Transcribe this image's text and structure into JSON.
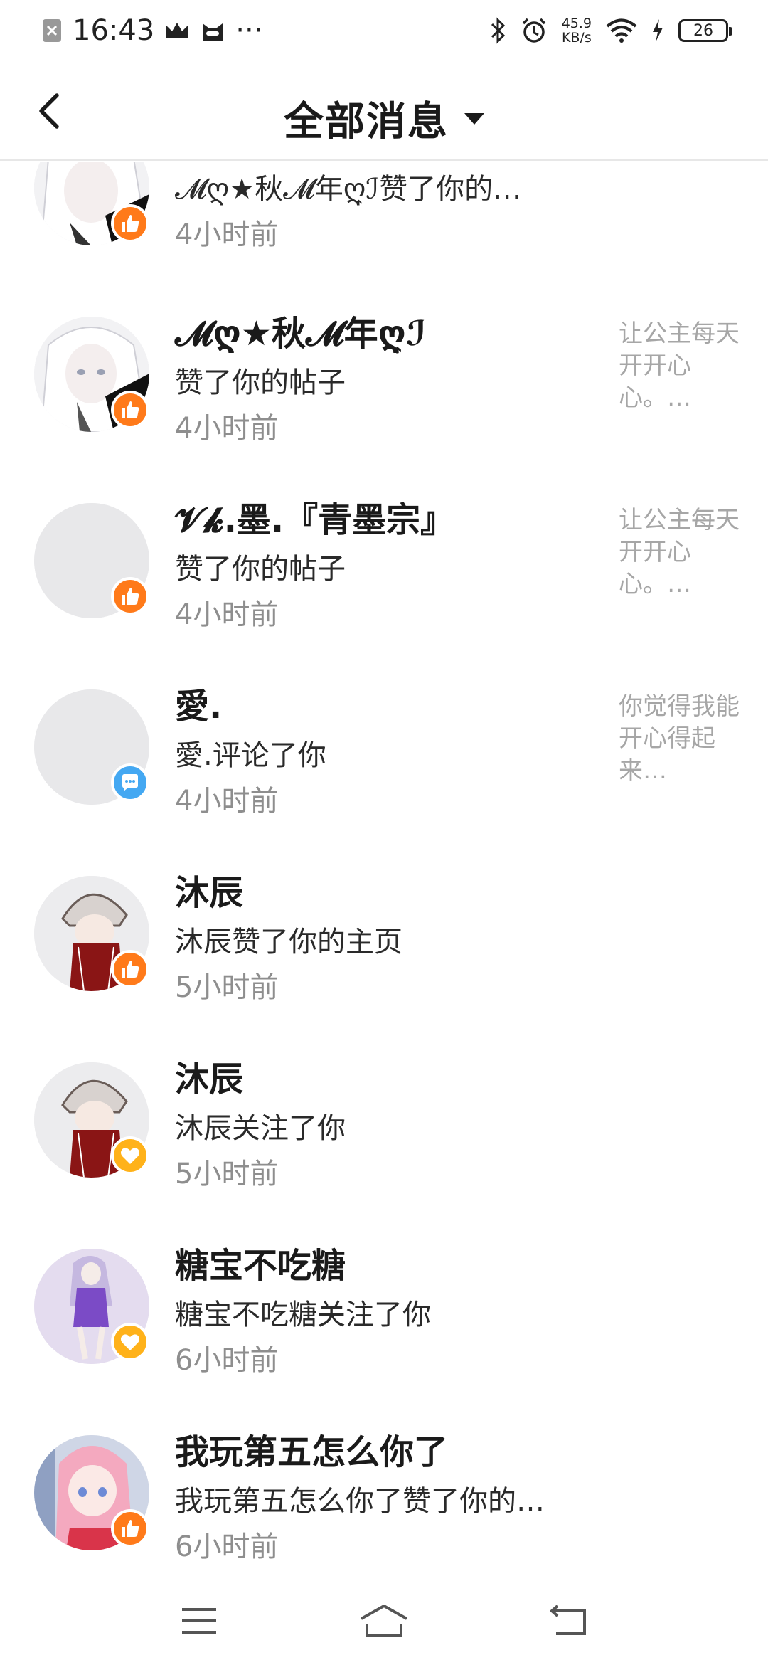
{
  "status_bar": {
    "time": "16:43",
    "more": "···",
    "net_speed_value": "45.9",
    "net_speed_unit": "KB/s",
    "battery": "26",
    "icons": [
      "close-notification-icon",
      "crown-icon",
      "cat-face-icon",
      "bluetooth-icon",
      "alarm-icon",
      "wifi-icon",
      "charging-icon",
      "battery-icon"
    ]
  },
  "header": {
    "title": "全部消息",
    "back_icon": "chevron-left-icon",
    "dropdown_icon": "caret-down-icon"
  },
  "messages": [
    {
      "name": "",
      "action": "𝓜ღ★秋𝓜年ღ͎ℐ赞了你的…",
      "time": "4小时前",
      "preview": "",
      "badge": "like",
      "avatar": "white-hair-girl-avatar"
    },
    {
      "name": "𝓜ღ★秋𝓜年ღ͎ℐ",
      "action": "赞了你的帖子",
      "time": "4小时前",
      "preview": "让公主每天开开心心。…",
      "badge": "like",
      "avatar": "white-hair-girl-avatar"
    },
    {
      "name": "𝓥𝓴.墨.『青墨宗』",
      "action": "赞了你的帖子",
      "time": "4小时前",
      "preview": "让公主每天开开心心。…",
      "badge": "like",
      "avatar": "blank-avatar"
    },
    {
      "name": "愛.",
      "action": "愛.评论了你",
      "time": "4小时前",
      "preview": "你觉得我能开心得起来…",
      "badge": "comment",
      "avatar": "blank-avatar"
    },
    {
      "name": "沐辰",
      "action": "沐辰赞了你的主页",
      "time": "5小时前",
      "preview": "",
      "badge": "like",
      "avatar": "chibi-boy-avatar"
    },
    {
      "name": "沐辰",
      "action": "沐辰关注了你",
      "time": "5小时前",
      "preview": "",
      "badge": "follow",
      "avatar": "chibi-boy-avatar"
    },
    {
      "name": "糖宝不吃糖",
      "action": "糖宝不吃糖关注了你",
      "time": "6小时前",
      "preview": "",
      "badge": "follow",
      "avatar": "purple-anime-girl-avatar"
    },
    {
      "name": "我玩第五怎么你了",
      "action": "我玩第五怎么你了赞了你的…",
      "time": "6小时前",
      "preview": "",
      "badge": "like",
      "avatar": "pink-hair-girl-avatar"
    }
  ],
  "nav_bar": {
    "icons": [
      "menu-icon",
      "home-icon",
      "back-icon"
    ]
  },
  "colors": {
    "like_badge": "#ff7a1a",
    "follow_badge": "#ffb21a",
    "comment_badge": "#44a8f2",
    "time_text": "#8e8e8e",
    "preview_text": "#a6a6a6"
  }
}
